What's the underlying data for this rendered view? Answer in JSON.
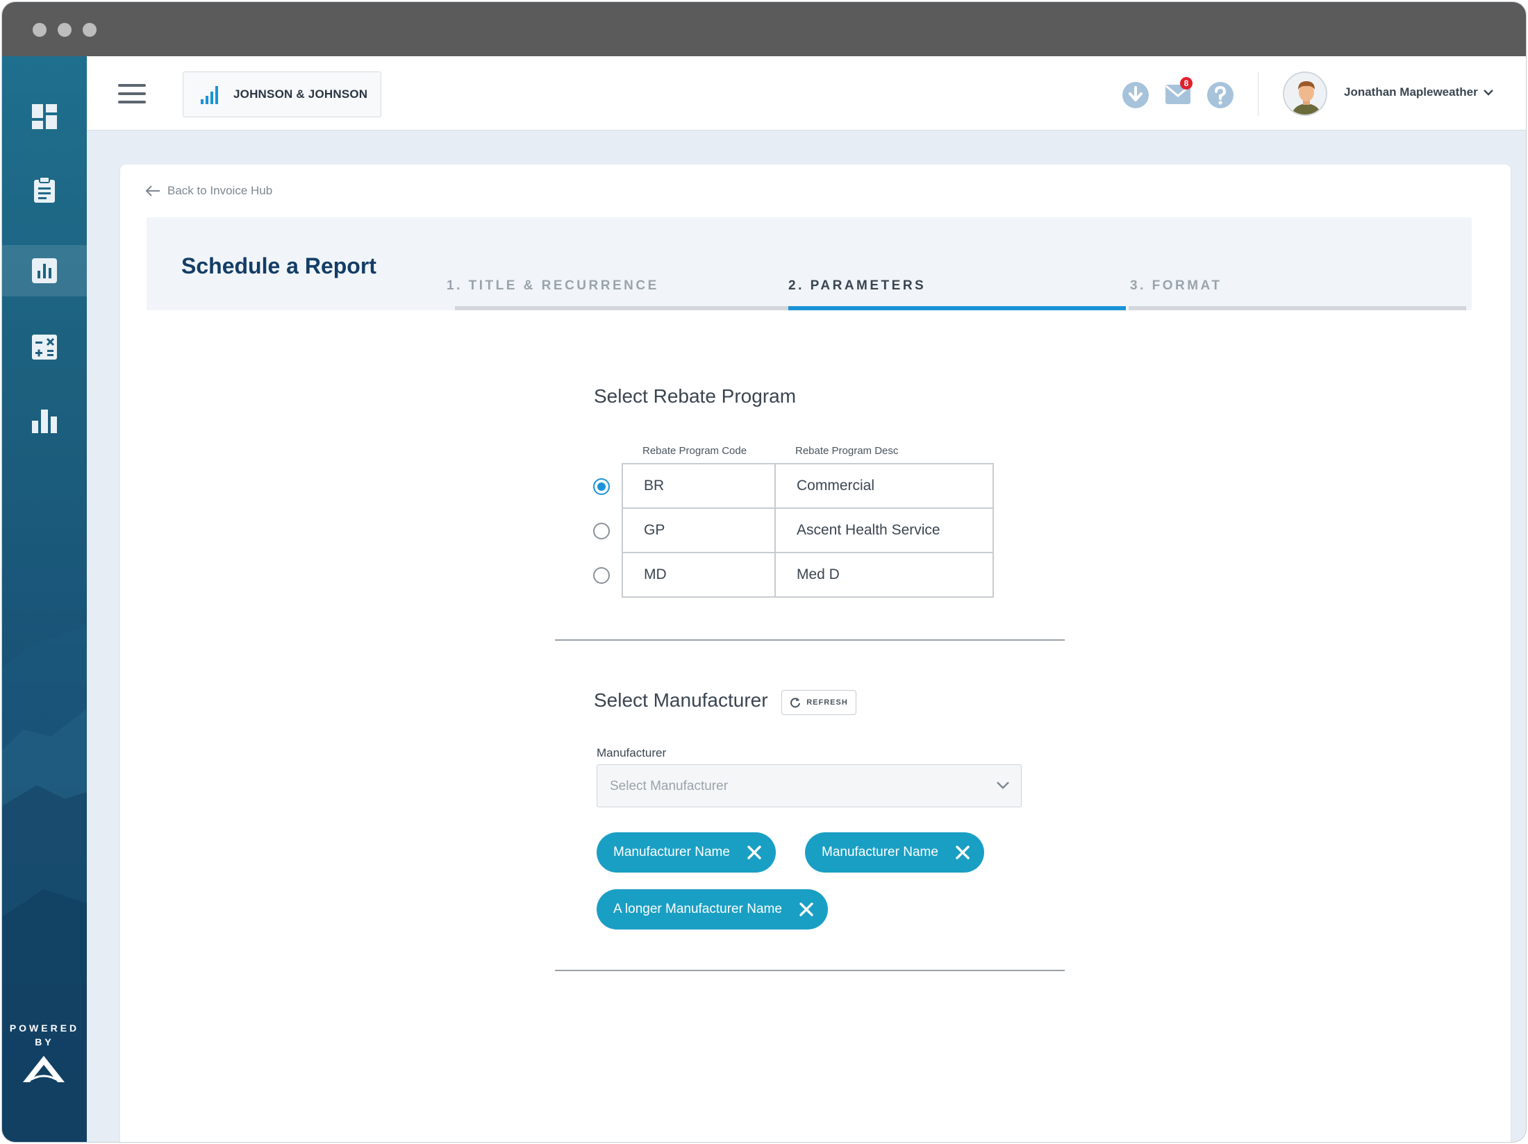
{
  "brand": {
    "name": "JOHNSON & JOHNSON"
  },
  "header": {
    "notification_count": "8",
    "user_name": "Jonathan Mapleweather"
  },
  "sidebar": {
    "items": [
      {
        "icon": "dashboard-icon"
      },
      {
        "icon": "clipboard-icon"
      },
      {
        "icon": "report-chart-icon",
        "active": true
      },
      {
        "icon": "calculator-icon"
      },
      {
        "icon": "bar-chart-icon"
      }
    ],
    "powered_by": "POWERED BY",
    "logo_text": "Ascent"
  },
  "page": {
    "back_link": "Back to Invoice Hub",
    "title": "Schedule a Report",
    "steps": [
      {
        "label": "1. TITLE & RECURRENCE",
        "state": "done"
      },
      {
        "label": "2. PARAMETERS",
        "state": "active"
      },
      {
        "label": "3. FORMAT",
        "state": "upcoming"
      }
    ]
  },
  "rebate": {
    "title": "Select Rebate Program",
    "col_code": "Rebate Program Code",
    "col_desc": "Rebate Program Desc",
    "rows": [
      {
        "code": "BR",
        "desc": "Commercial",
        "selected": true
      },
      {
        "code": "GP",
        "desc": "Ascent Health Service",
        "selected": false
      },
      {
        "code": "MD",
        "desc": "Med D",
        "selected": false
      }
    ]
  },
  "manufacturer": {
    "title": "Select Manufacturer",
    "refresh_label": "REFRESH",
    "field_label": "Manufacturer",
    "placeholder": "Select Manufacturer",
    "chips": [
      "Manufacturer Name",
      "Manufacturer Name",
      "A longer Manufacturer Name"
    ]
  },
  "colors": {
    "accent": "#1b93d6",
    "chip": "#1a9fc4",
    "title": "#133d66",
    "badge": "#e0212e"
  }
}
